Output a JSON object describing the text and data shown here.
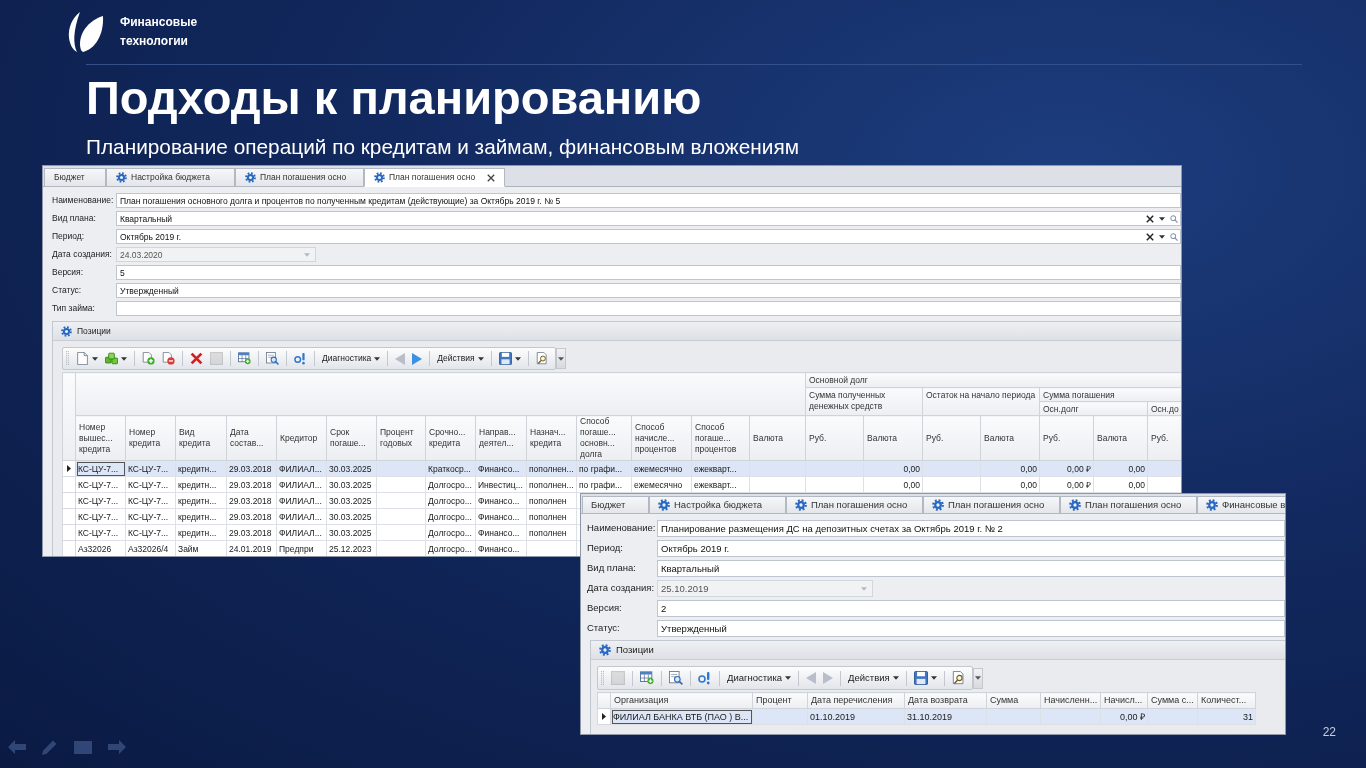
{
  "logo": {
    "lines": [
      "Финансовые",
      "технологии"
    ]
  },
  "title": "Подходы к планированию",
  "subtitle": "Планирование операций по кредитам и займам, финансовым вложениям",
  "screenshots": [
    {
      "tabs": [
        {
          "label": "Бюджет",
          "has_icon": false,
          "selected": false,
          "closable": false
        },
        {
          "label": "Настройка бюджета",
          "has_icon": true,
          "selected": false,
          "closable": false
        },
        {
          "label": "План погашения осно",
          "has_icon": true,
          "selected": false,
          "closable": false
        },
        {
          "label": "План погашения осно",
          "has_icon": true,
          "selected": true,
          "closable": true
        }
      ],
      "fields": [
        {
          "label": "Наименование:",
          "value": "План погашения основного долга и процентов по полученным кредитам (действующие) за Октябрь 2019 г. № 5",
          "kind": "text",
          "disabled": false
        },
        {
          "label": "Вид плана:",
          "value": "Квартальный",
          "kind": "lookup",
          "disabled": false
        },
        {
          "label": "Период:",
          "value": "Октябрь 2019 г.",
          "kind": "lookup",
          "disabled": false
        },
        {
          "label": "Дата создания:",
          "value": "24.03.2020",
          "kind": "date",
          "disabled": true
        },
        {
          "label": "Версия:",
          "value": "5",
          "kind": "text",
          "disabled": false
        },
        {
          "label": "Статус:",
          "value": "Утвержденный",
          "kind": "text",
          "disabled": false
        },
        {
          "label": "Тип займа:",
          "kind": "text",
          "disabled": false
        }
      ],
      "section": {
        "title": "Позиции"
      },
      "toolbar": {
        "groups": [
          [
            {
              "kind": "document",
              "dropdown": true,
              "disabled": false
            },
            {
              "kind": "cubes",
              "dropdown": true,
              "disabled": false
            }
          ],
          [
            {
              "kind": "add",
              "dropdown": false,
              "disabled": false
            },
            {
              "kind": "remove",
              "dropdown": false,
              "disabled": false
            }
          ],
          [
            {
              "kind": "delete",
              "dropdown": false,
              "disabled": false
            },
            {
              "kind": "blank",
              "dropdown": false,
              "disabled": true
            }
          ],
          [
            {
              "kind": "table",
              "dropdown": false,
              "disabled": false
            }
          ],
          [
            {
              "kind": "lookup",
              "dropdown": false,
              "disabled": false
            }
          ],
          [
            {
              "kind": "info",
              "dropdown": false,
              "disabled": false
            }
          ],
          [
            {
              "kind": "menu",
              "label": "Диагностика",
              "dropdown": true,
              "disabled": false
            }
          ],
          [
            {
              "kind": "back",
              "dropdown": false,
              "disabled": true
            },
            {
              "kind": "forward",
              "dropdown": false,
              "disabled": false
            }
          ],
          [
            {
              "kind": "menu",
              "label": "Действия",
              "dropdown": true,
              "disabled": false
            }
          ],
          [
            {
              "kind": "save",
              "dropdown": true,
              "disabled": false
            }
          ],
          [
            {
              "kind": "preview",
              "dropdown": false,
              "disabled": false
            }
          ]
        ],
        "overflow": true
      },
      "table": {
        "columns": [
          {
            "label": "Номер вышес... кредита",
            "kind": "text"
          },
          {
            "label": "Номер кредита",
            "kind": "text"
          },
          {
            "label": "Вид кредита",
            "kind": "text"
          },
          {
            "label": "Дата состав...",
            "kind": "text"
          },
          {
            "label": "Кредитор",
            "kind": "text"
          },
          {
            "label": "Срок погаше...",
            "kind": "text"
          },
          {
            "label": "Процент годовых"
          },
          {
            "label": "Срочно... кредита",
            "kind": "text"
          },
          {
            "label": "Направ... деятел...",
            "kind": "text"
          },
          {
            "label": "Назнач... кредита",
            "kind": "text"
          },
          {
            "label": "Способ погаше... основн... долга",
            "kind": "text"
          },
          {
            "label": "Способ начисле... процентов",
            "kind": "text"
          },
          {
            "label": "Способ погаше... процентов",
            "kind": "text"
          },
          {
            "label": "Валюта"
          },
          {
            "label": "Основной долг",
            "colspan": 7,
            "children": [
              {
                "label": "Сумма полученных денежных средств",
                "colspan": 2,
                "children": [
                  {
                    "label": "Руб."
                  },
                  {
                    "label": "Валюта",
                    "kind": "number"
                  }
                ]
              },
              {
                "label": "Остаток на начало периода",
                "colspan": 2,
                "children": [
                  {
                    "label": "Руб."
                  },
                  {
                    "label": "Валюта",
                    "kind": "number"
                  }
                ]
              },
              {
                "label": "Сумма погашения",
                "colspan": 3,
                "children": [
                  {
                    "label": "Осн.долг",
                    "colspan": 2,
                    "children": [
                      {
                        "label": "Руб.",
                        "kind": "number"
                      },
                      {
                        "label": "Валюта",
                        "kind": "number"
                      }
                    ]
                  },
                  {
                    "label": "Осн.до",
                    "children": [
                      {
                        "label": "Руб."
                      }
                    ]
                  }
                ]
              }
            ]
          }
        ],
        "rows": [
          {
            "selected": true,
            "cells": [
              "КС-ЦУ-7...",
              "КС-ЦУ-7...",
              "кредитн...",
              "29.03.2018",
              "ФИЛИАЛ...",
              "30.03.2025",
              null,
              "Краткоср...",
              "Финансо...",
              "пополнен...",
              "по графи...",
              "ежемесячно",
              "ежекварт...",
              null,
              null,
              "0,00",
              null,
              "0,00",
              "0,00 ₽",
              "0,00"
            ]
          },
          {
            "selected": false,
            "cells": [
              "КС-ЦУ-7...",
              "КС-ЦУ-7...",
              "кредитн...",
              "29.03.2018",
              "ФИЛИАЛ...",
              "30.03.2025",
              null,
              "Долгосро...",
              "Инвестиц...",
              "пополнен...",
              "по графи...",
              "ежемесячно",
              "ежекварт...",
              null,
              null,
              "0,00",
              null,
              "0,00",
              "0,00 ₽",
              "0,00"
            ]
          },
          {
            "selected": false,
            "cells": [
              "КС-ЦУ-7...",
              "КС-ЦУ-7...",
              "кредитн...",
              "29.03.2018",
              "ФИЛИАЛ...",
              "30.03.2025",
              null,
              "Долгосро...",
              "Финансо...",
              "пополнен"
            ]
          },
          {
            "selected": false,
            "cells": [
              "КС-ЦУ-7...",
              "КС-ЦУ-7...",
              "кредитн...",
              "29.03.2018",
              "ФИЛИАЛ...",
              "30.03.2025",
              null,
              "Долгосро...",
              "Финансо...",
              "пополнен"
            ]
          },
          {
            "selected": false,
            "cells": [
              "КС-ЦУ-7...",
              "КС-ЦУ-7...",
              "кредитн...",
              "29.03.2018",
              "ФИЛИАЛ...",
              "30.03.2025",
              null,
              "Долгосро...",
              "Финансо...",
              "пополнен"
            ]
          },
          {
            "selected": false,
            "cells": [
              "Аз32026",
              "Аз32026/4",
              "Займ",
              "24.01.2019",
              "Предпри",
              "25.12.2023",
              null,
              "Долгосро...",
              "Финансо..."
            ]
          }
        ]
      }
    },
    {
      "tabs": [
        {
          "label": "Бюджет",
          "has_icon": false,
          "selected": false,
          "closable": false
        },
        {
          "label": "Настройка бюджета",
          "has_icon": true,
          "selected": false,
          "closable": false
        },
        {
          "label": "План погашения осно",
          "has_icon": true,
          "selected": false,
          "closable": false
        },
        {
          "label": "План погашения осно",
          "has_icon": true,
          "selected": false,
          "closable": false
        },
        {
          "label": "План погашения осно",
          "has_icon": true,
          "selected": false,
          "closable": false
        },
        {
          "label": "Финансовые в",
          "has_icon": true,
          "selected": false,
          "closable": false
        }
      ],
      "fields": [
        {
          "label": "Наименование:",
          "value": "Планирование размещения ДС на депозитных счетах за Октябрь 2019 г. № 2",
          "kind": "text",
          "disabled": false
        },
        {
          "label": "Период:",
          "value": "Октябрь 2019 г.",
          "kind": "text",
          "disabled": false
        },
        {
          "label": "Вид плана:",
          "value": "Квартальный",
          "kind": "text",
          "disabled": false
        },
        {
          "label": "Дата создания:",
          "value": "25.10.2019",
          "kind": "date",
          "disabled": true
        },
        {
          "label": "Версия:",
          "value": "2",
          "kind": "text",
          "disabled": false
        },
        {
          "label": "Статус:",
          "value": "Утвержденный",
          "kind": "text",
          "disabled": false
        }
      ],
      "section": {
        "title": "Позиции"
      },
      "toolbar": {
        "groups": [
          [
            {
              "kind": "blank",
              "dropdown": false,
              "disabled": true
            }
          ],
          [
            {
              "kind": "table",
              "dropdown": false,
              "disabled": false
            }
          ],
          [
            {
              "kind": "lookup",
              "dropdown": false,
              "disabled": false
            }
          ],
          [
            {
              "kind": "info",
              "dropdown": false,
              "disabled": false
            }
          ],
          [
            {
              "kind": "menu",
              "label": "Диагностика",
              "dropdown": true,
              "disabled": false
            }
          ],
          [
            {
              "kind": "back",
              "dropdown": false,
              "disabled": true
            },
            {
              "kind": "forward",
              "dropdown": false,
              "disabled": true
            }
          ],
          [
            {
              "kind": "menu",
              "label": "Действия",
              "dropdown": true,
              "disabled": false
            }
          ],
          [
            {
              "kind": "save",
              "dropdown": true,
              "disabled": false
            }
          ],
          [
            {
              "kind": "preview",
              "dropdown": false,
              "disabled": false
            }
          ]
        ],
        "overflow": true
      },
      "table": {
        "columns": [
          {
            "label": "Организация",
            "kind": "text"
          },
          {
            "label": "Процент"
          },
          {
            "label": "Дата перечисления",
            "kind": "text"
          },
          {
            "label": "Дата возврата",
            "kind": "text"
          },
          {
            "label": "Сумма"
          },
          {
            "label": "Начисленн..."
          },
          {
            "label": "Начисл...",
            "kind": "number"
          },
          {
            "label": "Сумма с..."
          },
          {
            "label": "Количест...",
            "kind": "number"
          }
        ],
        "rows": [
          {
            "selected": true,
            "cells": [
              "ФИЛИАЛ БАНКА ВТБ (ПАО ) В...",
              null,
              "01.10.2019",
              "31.10.2019",
              null,
              null,
              "0,00 ₽",
              null,
              "31"
            ]
          }
        ]
      }
    }
  ],
  "page_number": "22"
}
